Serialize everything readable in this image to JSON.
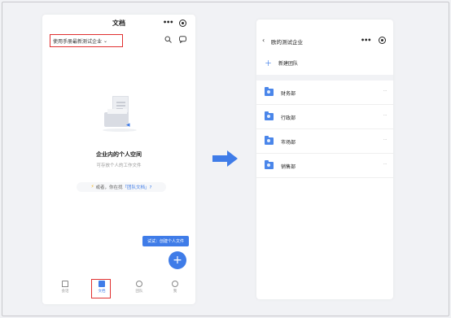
{
  "left_screen": {
    "title": "文档",
    "menu_dots": "•••",
    "space_selector": "使用手册最新测试企业",
    "chevron": "⌄",
    "search_icon": "search-icon",
    "chat_icon": "chat-bubble-icon",
    "empty_state": {
      "title": "企业内的个人空间",
      "subtitle": "可存放个人的工作文件",
      "tip_prefix": "或者，你在找",
      "tip_link": "「团队文档」?"
    },
    "tooltip": "试试：创建个人文件",
    "fab_label": "+",
    "tabs": [
      {
        "label": "会话",
        "icon": "home-icon",
        "active": false
      },
      {
        "label": "文档",
        "icon": "document-icon",
        "active": true
      },
      {
        "label": "团队",
        "icon": "team-icon",
        "active": false
      },
      {
        "label": "我",
        "icon": "profile-icon",
        "active": false
      }
    ]
  },
  "arrow_icon": "right-arrow-icon",
  "right_screen": {
    "back_icon": "‹",
    "title": "欧的测试企业",
    "menu_dots": "•••",
    "new_team_label": "新建团队",
    "departments": [
      {
        "name": "财务部",
        "more": "···"
      },
      {
        "name": "行政部",
        "more": "···"
      },
      {
        "name": "市场部",
        "more": "···"
      },
      {
        "name": "销售部",
        "more": "···"
      }
    ]
  },
  "colors": {
    "accent": "#3f7ce8",
    "highlight_border": "#e03030",
    "background": "#f1f2f5"
  }
}
